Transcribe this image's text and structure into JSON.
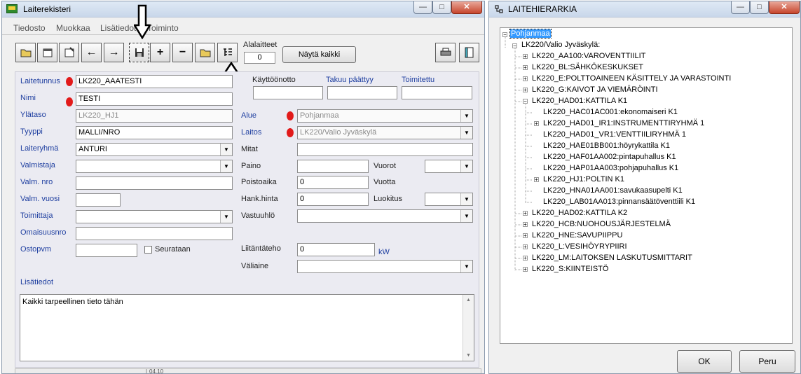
{
  "main_window": {
    "title": "Laiterekisteri",
    "controls": {
      "minimize": "—",
      "maximize": "□",
      "close": "✕"
    },
    "menu": [
      "Tiedosto",
      "Muokkaa",
      "Lisätiedot",
      "Toiminto"
    ],
    "toolbar": {
      "counter_label": "Alalaitteet",
      "counter_value": "0",
      "show_all_button": "Näytä kaikki"
    },
    "form": {
      "laitetunnus": {
        "label": "Laitetunnus",
        "value": "LK220_AAATESTI"
      },
      "nimi": {
        "label": "Nimi",
        "value": "TESTI"
      },
      "ylataso": {
        "label": "Ylätaso",
        "value": "LK220_HJ1"
      },
      "tyyppi": {
        "label": "Tyyppi",
        "value": "MALLI/NRO"
      },
      "laiteryhma": {
        "label": "Laiteryhmä",
        "value": "ANTURI"
      },
      "valmistaja": {
        "label": "Valmistaja",
        "value": ""
      },
      "valm_nro": {
        "label": "Valm. nro",
        "value": ""
      },
      "valm_vuosi": {
        "label": "Valm. vuosi",
        "value": ""
      },
      "toimittaja": {
        "label": "Toimittaja",
        "value": ""
      },
      "omaisuusnro": {
        "label": "Omaisuusnro",
        "value": ""
      },
      "ostopvm": {
        "label": "Ostopvm",
        "value": ""
      },
      "seurataan": {
        "label": "Seurataan",
        "checked": false
      },
      "kayttoonotto": {
        "label": "Käyttöönotto",
        "value": ""
      },
      "takuu": {
        "label": "Takuu päättyy",
        "value": ""
      },
      "toimitettu": {
        "label": "Toimitettu",
        "value": ""
      },
      "alue": {
        "label": "Alue",
        "value": "Pohjanmaa"
      },
      "laitos": {
        "label": "Laitos",
        "value": "LK220/Valio Jyväskylä"
      },
      "mitat": {
        "label": "Mitat",
        "value": ""
      },
      "paino": {
        "label": "Paino",
        "value": ""
      },
      "vuorot": {
        "label": "Vuorot",
        "value": ""
      },
      "poistoaika": {
        "label": "Poistoaika",
        "value": "0"
      },
      "vuotta": {
        "label": "Vuotta"
      },
      "hank_hinta": {
        "label": "Hank.hinta",
        "value": "0"
      },
      "luokitus": {
        "label": "Luokitus",
        "value": ""
      },
      "vastuuhlo": {
        "label": "Vastuuhlö",
        "value": ""
      },
      "liitantateho": {
        "label": "Liitäntäteho",
        "value": "0",
        "unit": "kW"
      },
      "valiaine": {
        "label": "Väliaine",
        "value": ""
      },
      "lisatiedot": {
        "label": "Lisätiedot",
        "value": "Kaikki tarpeellinen tieto tähän"
      }
    },
    "status_text": "04.10"
  },
  "hierarchy_window": {
    "title": "LAITEHIERARKIA",
    "controls": {
      "minimize": "—",
      "maximize": "□",
      "close": "✕"
    },
    "root": "Pohjanmaa",
    "site": "LK220/Valio Jyväskylä:",
    "nodes": [
      "LK220_AA100:VAROVENTTIILIT",
      "LK220_BL:SÄHKÖKESKUKSET",
      "LK220_E:POLTTOAINEEN KÄSITTELY JA VARASTOINTI",
      "LK220_G:KAIVOT JA VIEMÄRÖINTI",
      "LK220_HAD01:KATTILA K1",
      "LK220_HAC01AC001:ekonomaiseri K1",
      "LK220_HAD01_IR1:INSTRUMENTTIRYHMÄ 1",
      "LK220_HAD01_VR1:VENTTIILIRYHMÄ 1",
      "LK220_HAE01BB001:höyrykattila K1",
      "LK220_HAF01AA002:pintapuhallus K1",
      "LK220_HAP01AA003:pohjapuhallus K1",
      "LK220_HJ1:POLTIN K1",
      "LK220_HNA01AA001:savukaasupelti K1",
      "LK220_LAB01AA013:pinnansäätöventtiili K1",
      "LK220_HAD02:KATTILA K2",
      "LK220_HCB:NUOHOUSJÄRJESTELMÄ",
      "LK220_HNE:SAVUPIIPPU",
      "LK220_L:VESIHÖYRYPIIRI",
      "LK220_LM:LAITOKSEN LASKUTUSMITTARIT",
      "LK220_S:KIINTEISTÖ"
    ],
    "ok_button": "OK",
    "cancel_button": "Peru"
  }
}
